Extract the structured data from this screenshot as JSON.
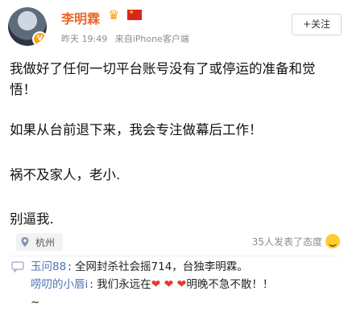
{
  "post": {
    "author": "李明霖",
    "meta_time": "昨天 19:49",
    "meta_source": "来自iPhone客户端",
    "follow_label": "+关注",
    "paragraphs": [
      "我做好了任何一切平台账号没有了或停运的准备和觉悟！",
      "如果从台前退下来，我会专注做幕后工作！",
      "祸不及家人，老小.",
      "别逼我."
    ],
    "location": "杭州",
    "reactions": "35人发表了态度"
  },
  "comments": [
    {
      "user": "玉问88",
      "text": ": 全网封杀社会摇714，台独李明霖。"
    },
    {
      "user": "唠叨的小唇i",
      "text_before": ": 我们永远在",
      "hearts": [
        "❤",
        "❤",
        "❤"
      ],
      "text_after": "明晚不急不散！！"
    },
    {
      "continuation": "~"
    }
  ],
  "icons": {
    "crown": "crown-icon",
    "flag": "china-flag-icon",
    "pin": "location-pin-icon",
    "comment": "comment-icon",
    "emoji": "smile-emoji-icon",
    "badge": "verified-badge-icon"
  }
}
